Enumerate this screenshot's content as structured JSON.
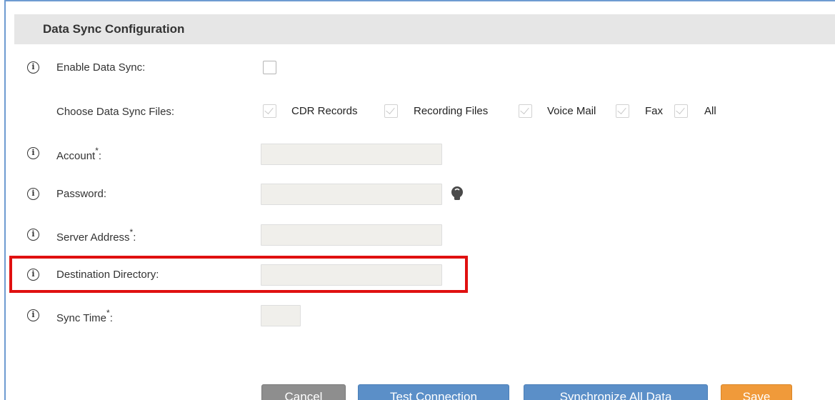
{
  "section": {
    "title": "Data Sync Configuration"
  },
  "fields": {
    "enable_data_sync": {
      "label": "Enable Data Sync:",
      "checked": false
    },
    "choose_files": {
      "label": "Choose Data Sync Files:",
      "options": [
        {
          "label": "CDR Records",
          "checked": true
        },
        {
          "label": "Recording Files",
          "checked": true
        },
        {
          "label": "Voice Mail",
          "checked": true
        },
        {
          "label": "Fax",
          "checked": true
        },
        {
          "label": "All",
          "checked": true
        }
      ]
    },
    "account": {
      "label": "Account",
      "required_mark": "*",
      "suffix": ":",
      "value": ""
    },
    "password": {
      "label": "Password:",
      "value": ""
    },
    "server_address": {
      "label": "Server Address",
      "required_mark": "*",
      "suffix": ":",
      "value": ""
    },
    "destination_directory": {
      "label": "Destination Directory:",
      "value": ""
    },
    "sync_time": {
      "label": "Sync Time",
      "required_mark": "*",
      "suffix": ":",
      "value": ""
    }
  },
  "info_icon_glyph": "i",
  "buttons": {
    "cancel": "Cancel",
    "test_connection": "Test Connection",
    "synchronize_all": "Synchronize All Data",
    "save": "Save"
  },
  "colors": {
    "header_bg": "#e6e6e6",
    "frame_border": "#6e9bd1",
    "highlight": "#e01010",
    "btn_blue": "#5b8fc8",
    "btn_gray": "#8e8e8e",
    "btn_orange": "#f09a3a"
  },
  "icons": {
    "info": "info-circle-icon",
    "password_hint": "lightbulb-icon"
  }
}
